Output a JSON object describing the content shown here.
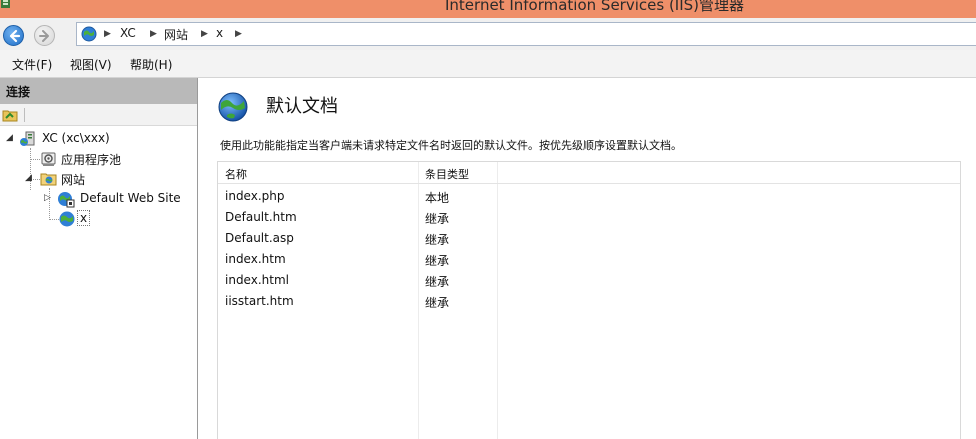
{
  "window": {
    "title": "Internet Information Services (IIS)管理器",
    "titlebar_color": "#ef8f69"
  },
  "address": {
    "crumbs": [
      "XC",
      "网站",
      "x"
    ]
  },
  "menu": {
    "items": [
      "文件(F)",
      "视图(V)",
      "帮助(H)"
    ]
  },
  "connections": {
    "header": "连接",
    "tree": {
      "server": "XC (xc\\xxx)",
      "app_pools": "应用程序池",
      "sites": "网站",
      "default_site": "Default Web Site",
      "selected_site": "x"
    }
  },
  "feature": {
    "title": "默认文档",
    "description": "使用此功能能指定当客户端未请求特定文件名时返回的默认文件。按优先级顺序设置默认文档。",
    "columns": [
      "名称",
      "条目类型"
    ],
    "rows": [
      {
        "name": "index.php",
        "type": "本地"
      },
      {
        "name": "Default.htm",
        "type": "继承"
      },
      {
        "name": "Default.asp",
        "type": "继承"
      },
      {
        "name": "index.htm",
        "type": "继承"
      },
      {
        "name": "index.html",
        "type": "继承"
      },
      {
        "name": "iisstart.htm",
        "type": "继承"
      }
    ]
  },
  "icons": {
    "nav_back": "back-arrow-icon",
    "nav_forward": "forward-arrow-icon",
    "address": "globe-icon",
    "feature": "globe-icon"
  }
}
